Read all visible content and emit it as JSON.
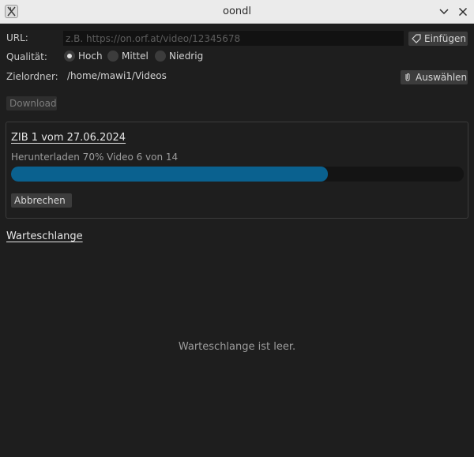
{
  "window": {
    "title": "oondl"
  },
  "form": {
    "url_label": "URL:",
    "url_placeholder": "z.B. https://on.orf.at/video/12345678",
    "url_value": "",
    "paste_label": "Einfügen",
    "quality_label": "Qualität:",
    "quality_options": [
      "Hoch",
      "Mittel",
      "Niedrig"
    ],
    "quality_selected": "Hoch",
    "folder_label": "Zielordner:",
    "folder_value": "/home/mawi1/Videos",
    "choose_label": "Auswählen",
    "download_label": "Download"
  },
  "job": {
    "title": "ZIB 1 vom 27.06.2024",
    "status": "Herunterladen 70% Video 6 von 14",
    "progress": 0.7,
    "cancel_label": "Abbrechen"
  },
  "queue": {
    "title": "Warteschlange",
    "empty_text": "Warteschlange ist leer."
  },
  "colors": {
    "background": "#1e1e1e",
    "accent": "#0a618f",
    "titlebar": "#ebebeb"
  },
  "icons": {
    "app": "app-icon",
    "minimize": "chevron-down-icon",
    "close": "close-icon",
    "paste": "tag-icon",
    "choose": "clip-icon"
  }
}
